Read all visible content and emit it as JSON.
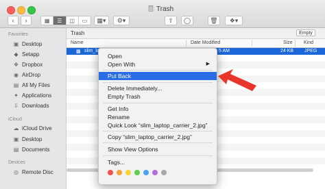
{
  "window": {
    "title": "Trash",
    "colors": {
      "selection": "#1b67d8",
      "menu_highlight": "#2a6ee6",
      "arrow": "#e8352a"
    }
  },
  "toolbar": {
    "view_icons": [
      "icon-view",
      "list-view",
      "column-view",
      "gallery-view"
    ],
    "arrange": "arrange-icon",
    "action": "gear-icon",
    "share": "share-icon",
    "tags": "tag-icon",
    "trash": "trash-icon",
    "dropbox": "dropbox-icon"
  },
  "sidebar": {
    "favorites_heading": "Favorites",
    "favorites": [
      {
        "label": "Desktop",
        "icon": "desktop-icon"
      },
      {
        "label": "Setapp",
        "icon": "setapp-icon"
      },
      {
        "label": "Dropbox",
        "icon": "dropbox-icon"
      },
      {
        "label": "AirDrop",
        "icon": "airdrop-icon"
      },
      {
        "label": "All My Files",
        "icon": "files-icon"
      },
      {
        "label": "Applications",
        "icon": "applications-icon"
      },
      {
        "label": "Downloads",
        "icon": "downloads-icon"
      }
    ],
    "icloud_heading": "iCloud",
    "icloud": [
      {
        "label": "iCloud Drive",
        "icon": "cloud-icon"
      },
      {
        "label": "Desktop",
        "icon": "desktop-icon"
      },
      {
        "label": "Documents",
        "icon": "documents-icon"
      }
    ],
    "devices_heading": "Devices",
    "devices": [
      {
        "label": "Remote Disc",
        "icon": "disc-icon"
      }
    ]
  },
  "pathbar": {
    "label": "Trash",
    "empty_button": "Empty"
  },
  "columns": {
    "name": "Name",
    "date": "Date Modified",
    "size": "Size",
    "kind": "Kind"
  },
  "file": {
    "name": "slim_laptop_ca",
    "date_tail": "5 AM",
    "size": "24 KB",
    "kind": "JPEG"
  },
  "menu": {
    "items": [
      {
        "label": "Open"
      },
      {
        "label": "Open With",
        "submenu": true
      },
      {
        "label": "Put Back",
        "highlighted": true
      },
      {
        "label": "Delete Immediately..."
      },
      {
        "label": "Empty Trash"
      },
      {
        "label": "Get Info"
      },
      {
        "label": "Rename"
      },
      {
        "label": "Quick Look “slim_laptop_carrier_2.jpg”"
      },
      {
        "label": "Copy “slim_laptop_carrier_2.jpg”"
      },
      {
        "label": "Show View Options"
      },
      {
        "label": "Tags..."
      }
    ],
    "tag_colors": [
      "#f4524d",
      "#f7a234",
      "#f6d434",
      "#5fd04a",
      "#48a5f5",
      "#b46cd9",
      "#a8a8a8"
    ]
  }
}
